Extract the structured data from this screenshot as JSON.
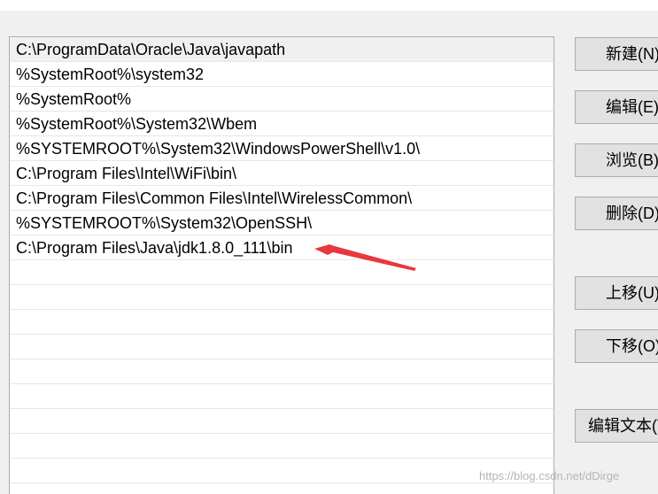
{
  "path_list": {
    "items": [
      "C:\\ProgramData\\Oracle\\Java\\javapath",
      "%SystemRoot%\\system32",
      "%SystemRoot%",
      "%SystemRoot%\\System32\\Wbem",
      "%SYSTEMROOT%\\System32\\WindowsPowerShell\\v1.0\\",
      "C:\\Program Files\\Intel\\WiFi\\bin\\",
      "C:\\Program Files\\Common Files\\Intel\\WirelessCommon\\",
      "%SYSTEMROOT%\\System32\\OpenSSH\\",
      "C:\\Program Files\\Java\\jdk1.8.0_111\\bin"
    ]
  },
  "buttons": {
    "new": "新建(N)",
    "edit": "编辑(E)",
    "browse": "浏览(B)...",
    "delete": "删除(D)",
    "move_up": "上移(U)",
    "move_down": "下移(O)",
    "edit_text": "编辑文本(T)..."
  },
  "annotation": {
    "arrow_color": "#e8383d",
    "arrow_icon": "red-pointer-arrow-icon"
  },
  "watermark": "https://blog.csdn.net/dDirge"
}
